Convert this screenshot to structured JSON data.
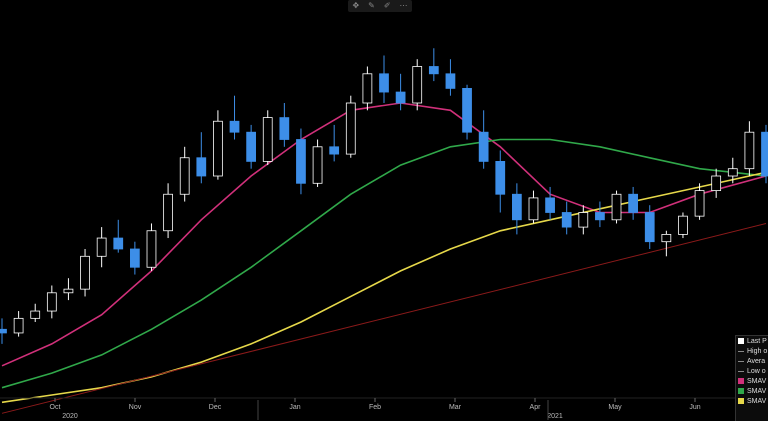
{
  "toolbar": {
    "icons": [
      "move-icon",
      "edit-icon",
      "pencil-icon",
      "more-icon"
    ]
  },
  "colors": {
    "background": "#000000",
    "candle_up": "#ffffff",
    "candle_down": "#3d8ee8",
    "sma_fast": "#d0307a",
    "sma_mid": "#30a84a",
    "sma_slow": "#e6d84a",
    "trend": "#8b1a1a"
  },
  "legend": {
    "items": [
      {
        "label": "Last P",
        "color": "#ffffff",
        "kind": "box"
      },
      {
        "label": "High o",
        "color": "#888888",
        "kind": "line"
      },
      {
        "label": "Avera",
        "color": "#888888",
        "kind": "line"
      },
      {
        "label": "Low o",
        "color": "#888888",
        "kind": "line"
      },
      {
        "label": "SMAV",
        "color": "#d0307a",
        "kind": "box"
      },
      {
        "label": "SMAV",
        "color": "#30a84a",
        "kind": "box"
      },
      {
        "label": "SMAV",
        "color": "#e6d84a",
        "kind": "box"
      }
    ]
  },
  "chart_data": {
    "type": "line",
    "title": "",
    "xlabel": "",
    "ylabel": "",
    "grid": false,
    "legend_position": "bottom-right",
    "x_ticks": [
      "Oct",
      "Nov",
      "Dec",
      "Jan",
      "Feb",
      "Mar",
      "Apr",
      "May",
      "Jun"
    ],
    "year_labels": [
      "2020",
      "2021"
    ],
    "x_range": [
      0,
      46
    ],
    "y_range": [
      0,
      100
    ],
    "candles": [
      [
        0,
        18,
        21,
        14,
        17
      ],
      [
        1,
        17,
        23,
        16,
        21
      ],
      [
        2,
        21,
        25,
        20,
        23
      ],
      [
        3,
        23,
        30,
        21,
        28
      ],
      [
        4,
        28,
        32,
        26,
        29
      ],
      [
        5,
        29,
        40,
        27,
        38
      ],
      [
        6,
        38,
        46,
        35,
        43
      ],
      [
        7,
        43,
        48,
        39,
        40
      ],
      [
        8,
        40,
        42,
        33,
        35
      ],
      [
        9,
        35,
        47,
        34,
        45
      ],
      [
        10,
        45,
        58,
        43,
        55
      ],
      [
        11,
        55,
        68,
        53,
        65
      ],
      [
        12,
        65,
        72,
        58,
        60
      ],
      [
        13,
        60,
        78,
        59,
        75
      ],
      [
        14,
        75,
        82,
        70,
        72
      ],
      [
        15,
        72,
        74,
        62,
        64
      ],
      [
        16,
        64,
        78,
        63,
        76
      ],
      [
        17,
        76,
        80,
        68,
        70
      ],
      [
        18,
        70,
        73,
        55,
        58
      ],
      [
        19,
        58,
        70,
        57,
        68
      ],
      [
        20,
        68,
        74,
        64,
        66
      ],
      [
        21,
        66,
        82,
        65,
        80
      ],
      [
        22,
        80,
        90,
        78,
        88
      ],
      [
        23,
        88,
        93,
        80,
        83
      ],
      [
        24,
        83,
        88,
        78,
        80
      ],
      [
        25,
        80,
        92,
        78,
        90
      ],
      [
        26,
        90,
        95,
        86,
        88
      ],
      [
        27,
        88,
        92,
        82,
        84
      ],
      [
        28,
        84,
        85,
        70,
        72
      ],
      [
        29,
        72,
        78,
        62,
        64
      ],
      [
        30,
        64,
        67,
        50,
        55
      ],
      [
        31,
        55,
        58,
        44,
        48
      ],
      [
        32,
        48,
        56,
        47,
        54
      ],
      [
        33,
        54,
        57,
        48,
        50
      ],
      [
        34,
        50,
        53,
        44,
        46
      ],
      [
        35,
        46,
        52,
        44,
        50
      ],
      [
        36,
        50,
        53,
        46,
        48
      ],
      [
        37,
        48,
        56,
        47,
        55
      ],
      [
        38,
        55,
        57,
        48,
        50
      ],
      [
        39,
        50,
        52,
        40,
        42
      ],
      [
        40,
        42,
        45,
        38,
        44
      ],
      [
        41,
        44,
        50,
        43,
        49
      ],
      [
        42,
        49,
        58,
        48,
        56
      ],
      [
        43,
        56,
        62,
        54,
        60
      ],
      [
        44,
        60,
        65,
        58,
        62
      ],
      [
        45,
        62,
        75,
        60,
        72
      ],
      [
        46,
        72,
        74,
        58,
        60
      ]
    ],
    "series": [
      {
        "name": "SMAV",
        "color": "#d0307a",
        "x": [
          0,
          3,
          6,
          9,
          12,
          15,
          18,
          21,
          24,
          27,
          30,
          33,
          36,
          39,
          42,
          46
        ],
        "values": [
          8,
          14,
          22,
          34,
          48,
          60,
          70,
          78,
          80,
          78,
          68,
          55,
          50,
          50,
          55,
          60
        ]
      },
      {
        "name": "SMAV",
        "color": "#30a84a",
        "x": [
          0,
          3,
          6,
          9,
          12,
          15,
          18,
          21,
          24,
          27,
          30,
          33,
          36,
          39,
          42,
          46
        ],
        "values": [
          2,
          6,
          11,
          18,
          26,
          35,
          45,
          55,
          63,
          68,
          70,
          70,
          68,
          65,
          62,
          60
        ]
      },
      {
        "name": "SMAV",
        "color": "#e6d84a",
        "x": [
          0,
          3,
          6,
          9,
          12,
          15,
          18,
          21,
          24,
          27,
          30,
          33,
          36,
          39,
          42,
          46
        ],
        "values": [
          -2,
          0,
          2,
          5,
          9,
          14,
          20,
          27,
          34,
          40,
          45,
          48,
          51,
          54,
          57,
          61
        ]
      },
      {
        "name": "",
        "color": "#8b1a1a",
        "x": [
          0,
          46
        ],
        "values": [
          -5,
          47
        ]
      }
    ]
  }
}
